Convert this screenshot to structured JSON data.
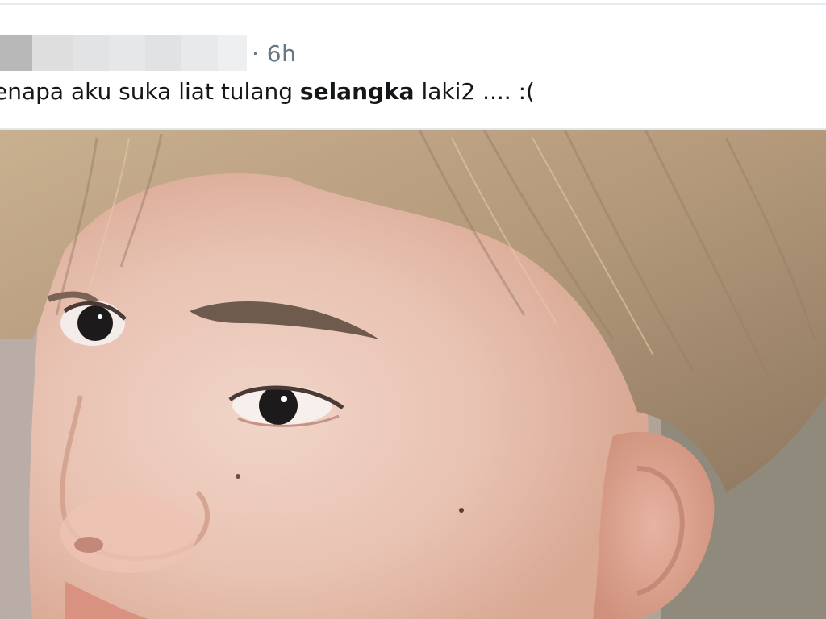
{
  "post": {
    "timestamp": "· 6h",
    "text_prefix": "enapa aku suka liat tulang ",
    "text_bold": "selangka",
    "text_suffix": " laki2 .... :("
  },
  "media": {
    "icon": "photo-icon",
    "description": ""
  },
  "colors": {
    "timestamp": "#657786",
    "text": "#14171a",
    "border": "#e1e8ed"
  }
}
